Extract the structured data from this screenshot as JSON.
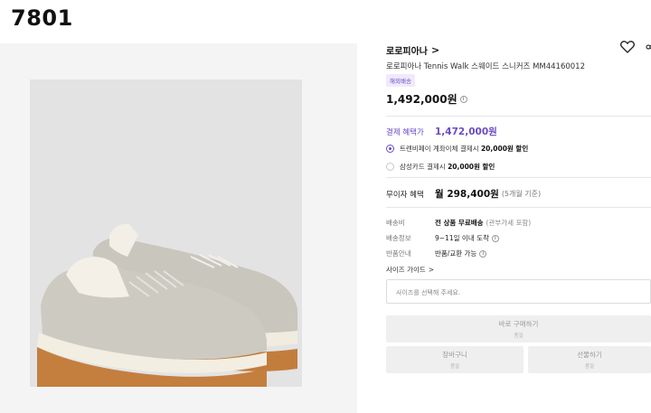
{
  "header": {
    "id_label": "7801"
  },
  "product": {
    "brand": "로로피아나",
    "brand_chevron": ">",
    "title": "로로피아나 Tennis Walk 스웨이드 스니커즈 MM44160012",
    "badge": "해외배송",
    "price": "1,492,000원",
    "info_glyph": "i"
  },
  "benefit": {
    "label": "결제 혜택가",
    "price": "1,472,000원",
    "options": [
      {
        "prefix": "트렌비페이 계좌이체 결제시",
        "bold": "20,000원 할인",
        "selected": true
      },
      {
        "prefix": "삼성카드 결제시",
        "bold": "20,000원 할인",
        "selected": false
      }
    ]
  },
  "installment": {
    "label": "무이자 혜택",
    "amount": "월 298,400원",
    "note": "(5개월 기준)"
  },
  "shipping": {
    "fee_label": "배송비",
    "fee_value": "전 상품 무료배송",
    "fee_note": "(관부가세 포함)",
    "info_label": "배송정보",
    "info_value": "9~11일 이내 도착",
    "return_label": "반품안내",
    "return_value": "반품/교환 가능"
  },
  "size": {
    "guide_label": "사이즈 가이드",
    "guide_chevron": ">",
    "select_placeholder": "사이즈를 선택해 주세요."
  },
  "actions": {
    "buy_label": "바로 구매하기",
    "buy_sub": "품절",
    "cart_label": "장바구니",
    "cart_sub": "품절",
    "gift_label": "선물하기",
    "gift_sub": "품절"
  },
  "colors": {
    "accent": "#6a4bc4",
    "gallery_bg": "#f4f4f5",
    "photo_bg": "#e3e3e4",
    "button_bg": "#efefef"
  },
  "icons": {
    "wishlist": "heart-icon",
    "share": "share-icon",
    "info": "info-icon",
    "chevron": "chevron-right-icon"
  }
}
